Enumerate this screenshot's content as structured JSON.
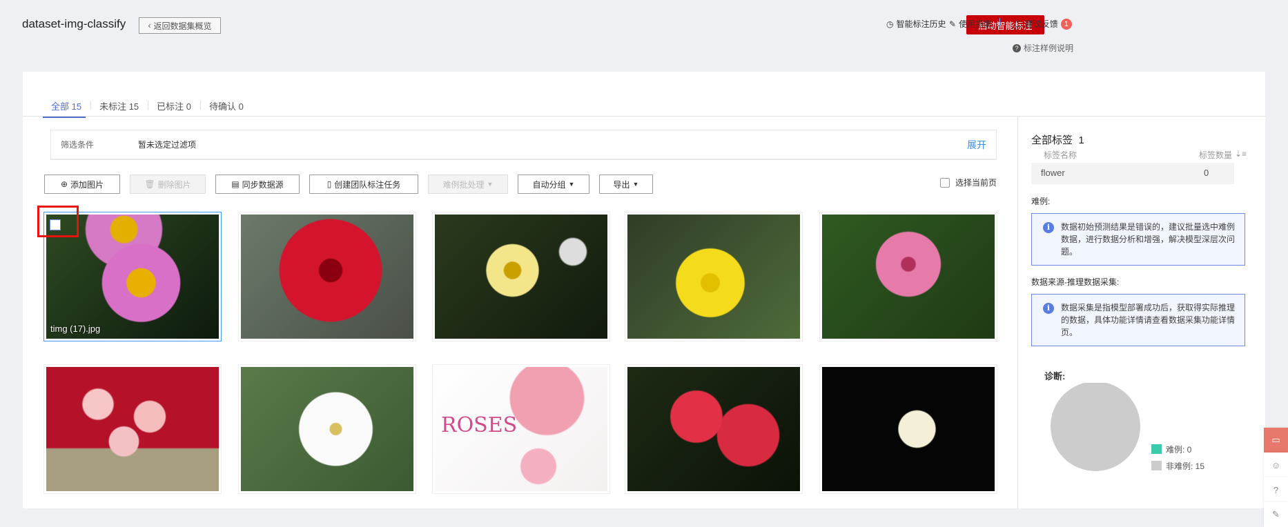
{
  "header": {
    "title": "dataset-img-classify",
    "back_label": "返回数据集概览",
    "start_label": "启动智能标注",
    "history_label": "智能标注历史",
    "guide_label": "使用指南",
    "feedback_label": "建议反馈",
    "feedback_badge": "1",
    "help_label": "标注样例说明"
  },
  "tabs": [
    {
      "label": "全部 15"
    },
    {
      "label": "未标注 15"
    },
    {
      "label": "已标注 0"
    },
    {
      "label": "待确认 0"
    }
  ],
  "filter": {
    "label": "筛选条件",
    "value": "暂未选定过滤项",
    "expand": "展开"
  },
  "toolbar": {
    "add": "添加图片",
    "delete": "删除图片",
    "sync": "同步数据源",
    "team": "创建团队标注任务",
    "hard": "难例批处理",
    "group": "自动分组",
    "export": "导出",
    "select_page": "选择当前页"
  },
  "images": [
    {
      "name": "timg (17).jpg"
    }
  ],
  "right": {
    "title": "全部标签",
    "count": "1",
    "col_name": "标签名称",
    "col_count": "标签数量",
    "labels": [
      {
        "name": "flower",
        "count": "0"
      }
    ],
    "hard_title": "难例:",
    "hard_info": "数据初始预测结果是错误的，建议批量选中难例数据，进行数据分析和增强，解决模型深层次问题。",
    "source_title": "数据来源-推理数据采集:",
    "source_info": "数据采集是指模型部署成功后，获取得实际推理的数据，具体功能详情请查看数据采集功能详情页。",
    "diag_title": "诊断:"
  },
  "chart_data": {
    "type": "pie",
    "categories": [
      "难例",
      "非难例"
    ],
    "values": [
      0,
      15
    ],
    "legend": [
      "难例: 0",
      "非难例: 15"
    ],
    "colors": [
      "#3ccbaa",
      "#cccccc"
    ],
    "legend_placement": "right"
  }
}
